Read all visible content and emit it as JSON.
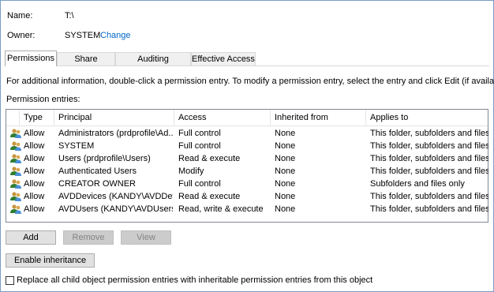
{
  "fields": {
    "name_label": "Name:",
    "name_value": "T:\\",
    "owner_label": "Owner:",
    "owner_value": "SYSTEM",
    "change_link": "Change"
  },
  "tabs": [
    {
      "label": "Permissions",
      "active": true
    },
    {
      "label": "Share",
      "active": false
    },
    {
      "label": "Auditing",
      "active": false
    },
    {
      "label": "Effective Access",
      "active": false
    }
  ],
  "info_text": "For additional information, double-click a permission entry. To modify a permission entry, select the entry and click Edit (if available).",
  "entries_label": "Permission entries:",
  "columns": {
    "type": "Type",
    "principal": "Principal",
    "access": "Access",
    "inherited": "Inherited from",
    "applies": "Applies to"
  },
  "rows": [
    {
      "type": "Allow",
      "principal": "Administrators (prdprofile\\Ad...",
      "access": "Full control",
      "inherited": "None",
      "applies": "This folder, subfolders and files"
    },
    {
      "type": "Allow",
      "principal": "SYSTEM",
      "access": "Full control",
      "inherited": "None",
      "applies": "This folder, subfolders and files"
    },
    {
      "type": "Allow",
      "principal": "Users (prdprofile\\Users)",
      "access": "Read & execute",
      "inherited": "None",
      "applies": "This folder, subfolders and files"
    },
    {
      "type": "Allow",
      "principal": "Authenticated Users",
      "access": "Modify",
      "inherited": "None",
      "applies": "This folder, subfolders and files"
    },
    {
      "type": "Allow",
      "principal": "CREATOR OWNER",
      "access": "Full control",
      "inherited": "None",
      "applies": "Subfolders and files only"
    },
    {
      "type": "Allow",
      "principal": "AVDDevices (KANDY\\AVDDevi...",
      "access": "Read & execute",
      "inherited": "None",
      "applies": "This folder, subfolders and files"
    },
    {
      "type": "Allow",
      "principal": "AVDUsers (KANDY\\AVDUsers)",
      "access": "Read, write & execute",
      "inherited": "None",
      "applies": "This folder, subfolders and files"
    }
  ],
  "buttons": {
    "add": "Add",
    "remove": "Remove",
    "view": "View",
    "enable_inheritance": "Enable inheritance"
  },
  "replace_checkbox": {
    "label": "Replace all child object permission entries with inheritable permission entries from this object",
    "checked": false
  },
  "icons": {
    "principal_icon": "users-icon"
  },
  "colors": {
    "link": "#0066cc",
    "frame_border": "#7a9cc6"
  }
}
